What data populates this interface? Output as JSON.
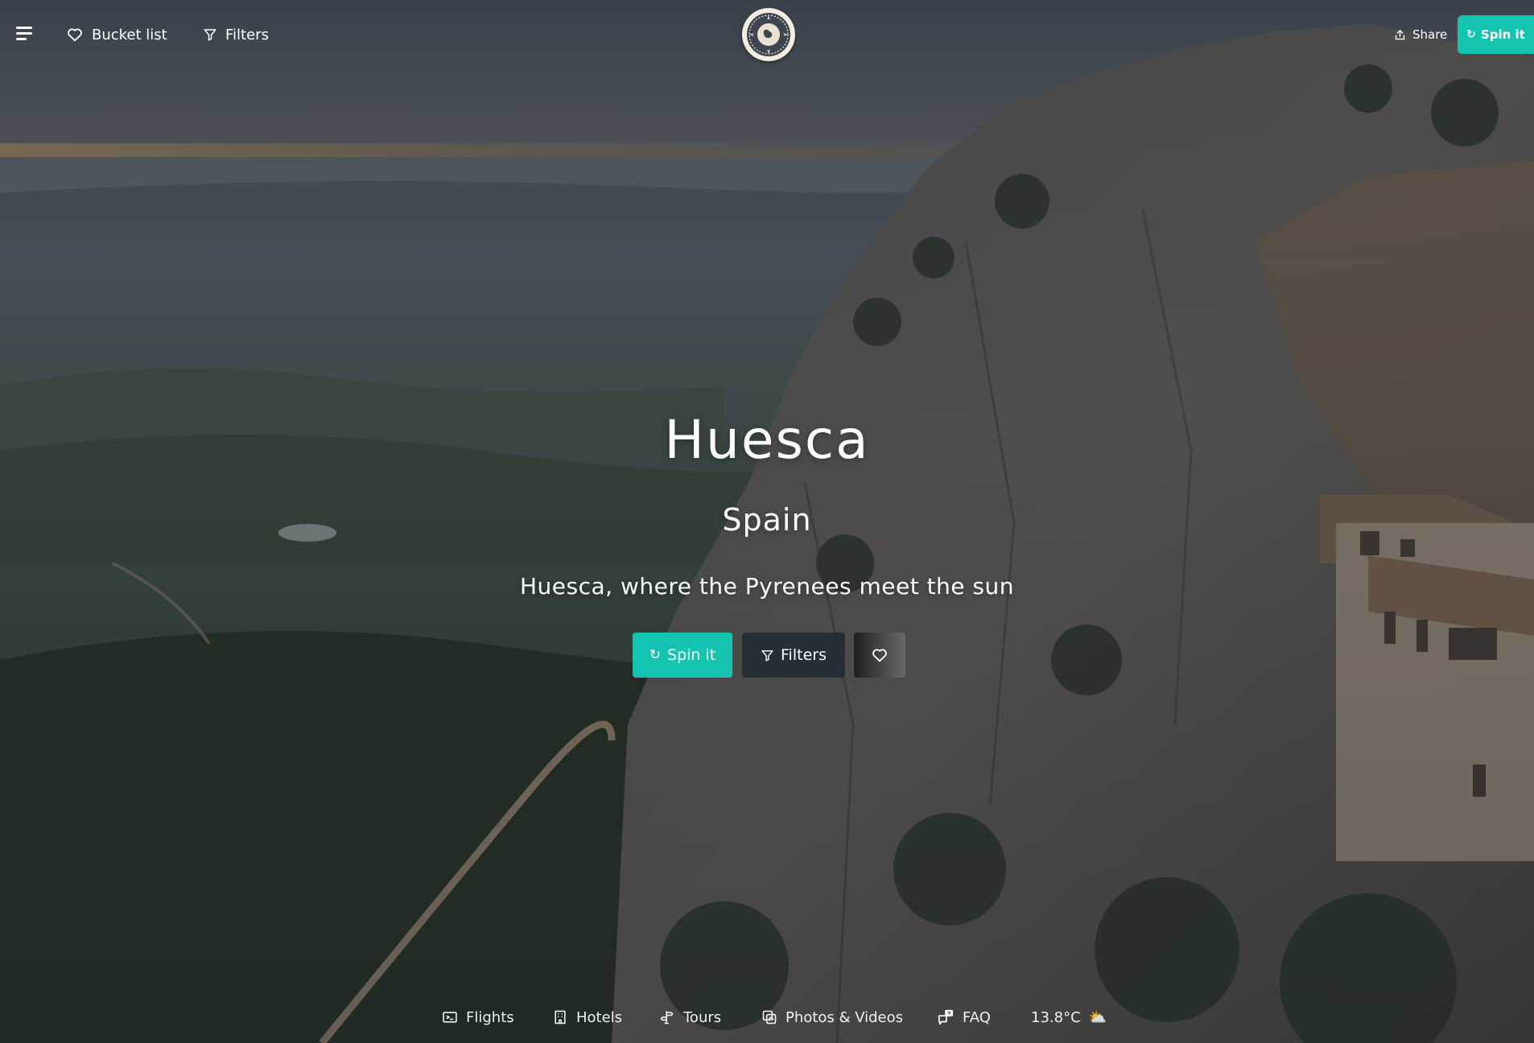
{
  "topbar": {
    "menu_icon": "hamburger-menu-icon",
    "bucket_list_label": "Bucket list",
    "bucket_list_icon": "heart-icon",
    "filters_label": "Filters",
    "filters_icon": "funnel-icon",
    "logo_icon": "globe-compass-icon",
    "share_label": "Share",
    "share_icon": "share-upload-icon",
    "spin_label": "Spin it",
    "spin_icon": "refresh-icon"
  },
  "hero": {
    "city": "Huesca",
    "country": "Spain",
    "tagline": "Huesca, where the Pyrenees meet the sun",
    "spin_label": "Spin it",
    "filters_label": "Filters",
    "heart_icon": "heart-icon"
  },
  "bottom_nav": {
    "items": [
      {
        "label": "Flights",
        "icon": "flight-ticket-icon"
      },
      {
        "label": "Hotels",
        "icon": "hotel-building-icon"
      },
      {
        "label": "Tours",
        "icon": "signpost-icon"
      },
      {
        "label": "Photos & Videos",
        "icon": "photos-icon"
      },
      {
        "label": "FAQ",
        "icon": "chat-question-icon"
      }
    ],
    "weather": {
      "temperature": "13.8°C",
      "icon": "⛅"
    }
  },
  "colors": {
    "accent": "#15c4b0",
    "dark_button": "#242c34",
    "text": "#ffffff"
  }
}
